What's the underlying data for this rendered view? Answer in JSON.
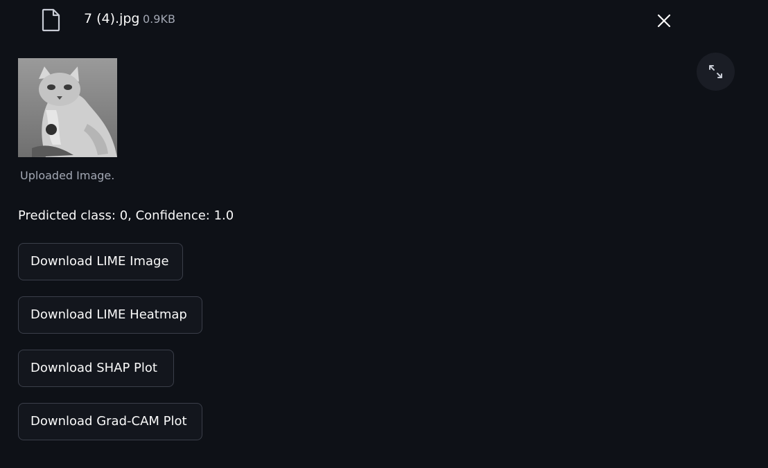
{
  "file": {
    "name": "7 (4).jpg",
    "size": "0.9KB",
    "icon": "file-icon"
  },
  "icons": {
    "close": "close-icon",
    "expand": "expand-icon"
  },
  "image": {
    "caption": "Uploaded Image."
  },
  "result": {
    "prediction_text": "Predicted class: 0, Confidence: 1.0"
  },
  "downloads": [
    {
      "label": "Download LIME Image"
    },
    {
      "label": "Download LIME Heatmap"
    },
    {
      "label": "Download SHAP Plot"
    },
    {
      "label": "Download Grad-CAM Plot"
    }
  ],
  "colors": {
    "background": "#0e1117",
    "text": "#fafafa",
    "muted_text": "#a3a8b4",
    "button_border": "#3b3f4a"
  }
}
